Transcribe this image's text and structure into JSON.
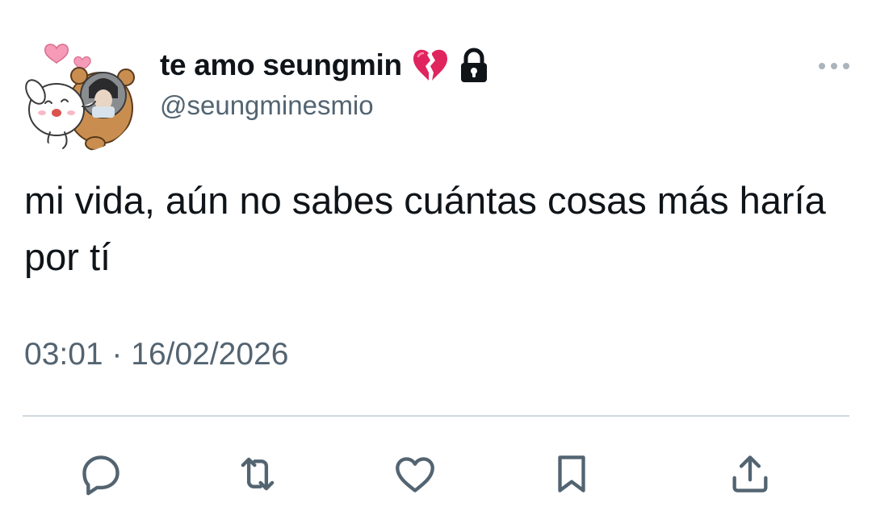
{
  "author": {
    "display_name": "te amo seungmin",
    "name_icons": [
      "broken-heart-icon",
      "lock-icon"
    ],
    "handle": "@seungminesmio",
    "avatar": "avatar-sticker-image"
  },
  "tweet": {
    "text": "mi vida, aún no sabes cuántas cosas más haría por tí",
    "timestamp": "03:01 · 16/02/2026"
  },
  "actions": [
    "reply-icon",
    "retweet-icon",
    "like-icon",
    "bookmark-icon",
    "share-icon"
  ],
  "colors": {
    "text_primary": "#0f1419",
    "text_secondary": "#536471",
    "divider": "#cfd9de",
    "broken_heart": "#e0245e"
  }
}
